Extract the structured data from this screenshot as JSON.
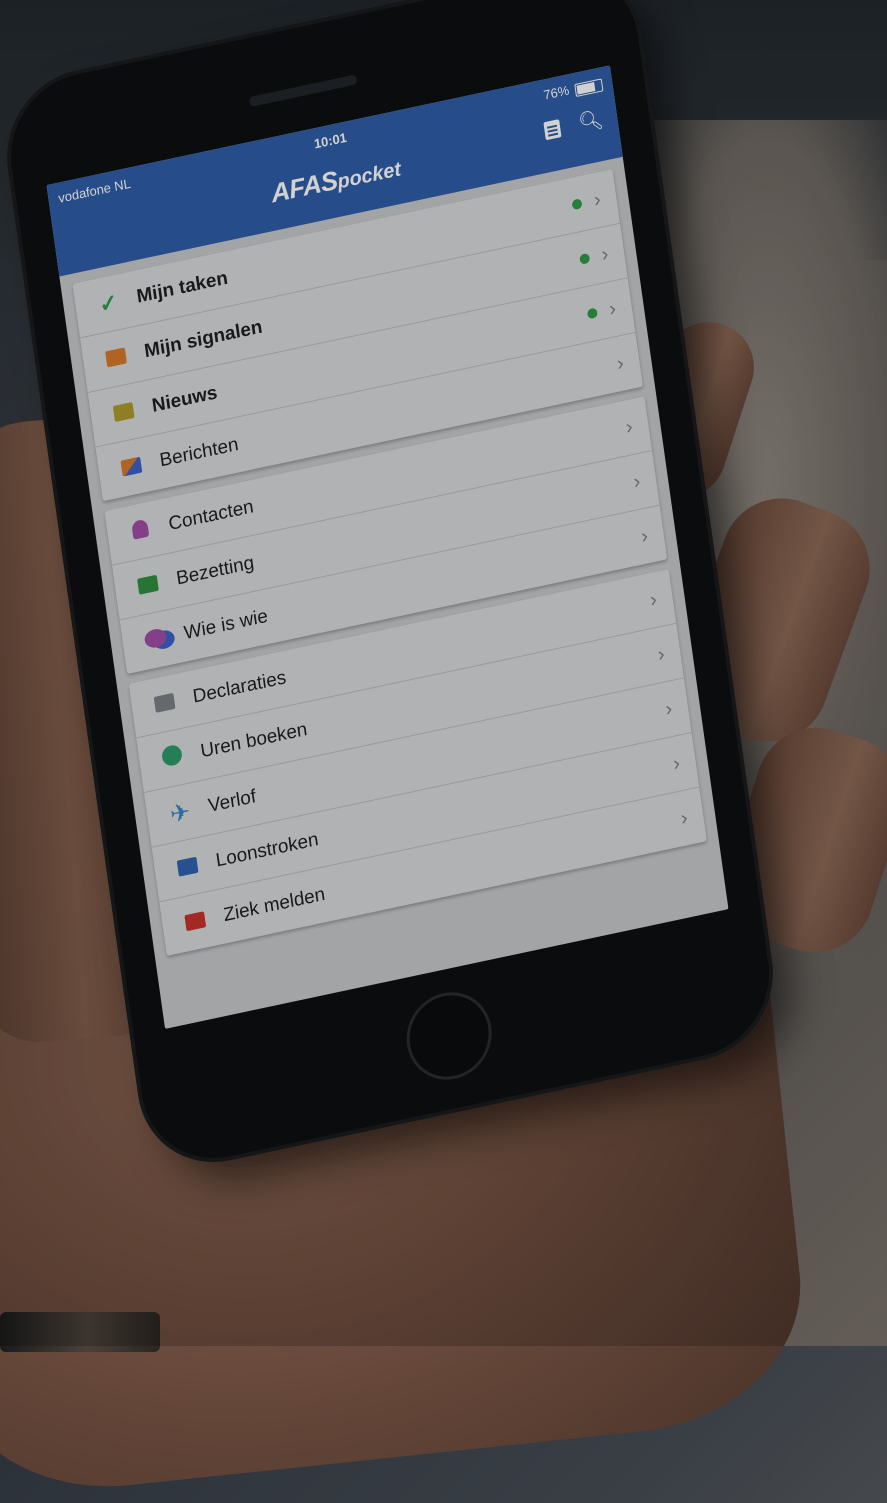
{
  "status_bar": {
    "carrier": "vodafone NL",
    "time": "10:01",
    "battery": "76%"
  },
  "header": {
    "brand_main": "AFAS",
    "brand_sub": "pocket",
    "actions": [
      {
        "icon": "document-icon"
      },
      {
        "icon": "search-icon"
      }
    ]
  },
  "menu_groups": [
    {
      "items": [
        {
          "label": "Mijn taken",
          "icon": "checkmark-icon",
          "bold": true,
          "badge_dot": true
        },
        {
          "label": "Mijn signalen",
          "icon": "signal-chat-icon",
          "bold": true,
          "badge_dot": true
        },
        {
          "label": "Nieuws",
          "icon": "news-icon",
          "bold": true,
          "badge_dot": true
        },
        {
          "label": "Berichten",
          "icon": "messages-icon",
          "bold": false,
          "badge_dot": false
        }
      ]
    },
    {
      "items": [
        {
          "label": "Contacten",
          "icon": "contact-person-icon",
          "bold": false,
          "badge_dot": false
        },
        {
          "label": "Bezetting",
          "icon": "occupancy-icon",
          "bold": false,
          "badge_dot": false
        },
        {
          "label": "Wie is wie",
          "icon": "people-icon",
          "bold": false,
          "badge_dot": false
        }
      ]
    },
    {
      "items": [
        {
          "label": "Declaraties",
          "icon": "receipt-icon",
          "bold": false,
          "badge_dot": false
        },
        {
          "label": "Uren boeken",
          "icon": "clock-icon",
          "bold": false,
          "badge_dot": false
        },
        {
          "label": "Verlof",
          "icon": "airplane-icon",
          "bold": false,
          "badge_dot": false
        },
        {
          "label": "Loonstroken",
          "icon": "payslip-icon",
          "bold": false,
          "badge_dot": false
        },
        {
          "label": "Ziek melden",
          "icon": "first-aid-kit-icon",
          "bold": false,
          "badge_dot": false
        }
      ]
    }
  ],
  "colors": {
    "header_bg": "#2f5fa8",
    "badge_dot": "#2e9b47"
  },
  "chevron_glyph": "›"
}
